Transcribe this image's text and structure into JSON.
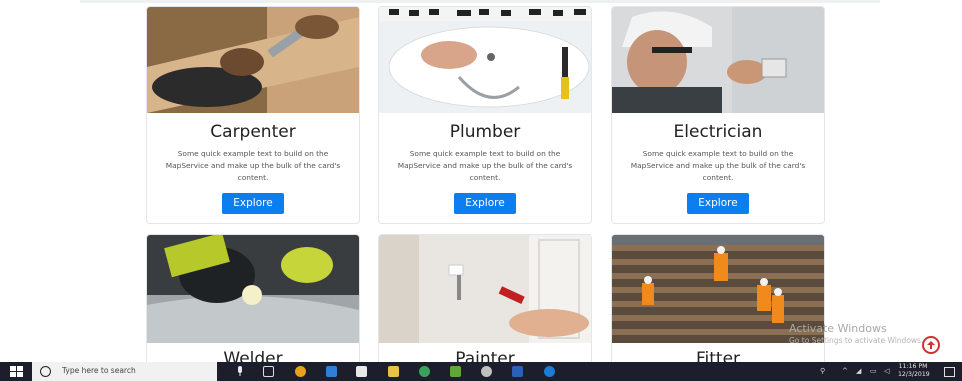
{
  "cards": [
    {
      "title": "Carpenter",
      "text": "Some quick example text to build on the MapService and make up the bulk of the card's content.",
      "button": "Explore"
    },
    {
      "title": "Plumber",
      "text": "Some quick example text to build on the MapService and make up the bulk of the card's content.",
      "button": "Explore"
    },
    {
      "title": "Electrician",
      "text": "Some quick example text to build on the MapService and make up the bulk of the card's content.",
      "button": "Explore"
    },
    {
      "title": "Welder"
    },
    {
      "title": "Painter"
    },
    {
      "title": "Fitter"
    }
  ],
  "watermark": {
    "line1": "Activate Windows",
    "line2": "Go to Settings to activate Windows."
  },
  "taskbar": {
    "search_placeholder": "Type here to search",
    "time": "11:16 PM",
    "date": "12/3/2019"
  },
  "colors": {
    "button": "#0b7ef0",
    "taskbar": "#1c1f2b",
    "scroll_top": "#d62f2f"
  }
}
